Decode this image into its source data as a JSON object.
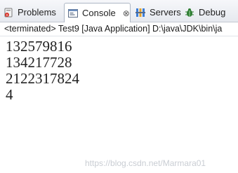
{
  "tabs": [
    {
      "label": "Problems",
      "icon": "problems-icon"
    },
    {
      "label": "Console",
      "icon": "console-icon",
      "close": "⊗"
    },
    {
      "label": "Servers",
      "icon": "servers-icon"
    },
    {
      "label": "Debug",
      "icon": "debug-icon"
    }
  ],
  "console_header": "<terminated> Test9 [Java Application] D:\\java\\JDK\\bin\\ja",
  "output_lines": [
    "132579816",
    "134217728",
    "2122317824",
    "4"
  ],
  "watermark": "https://blog.csdn.net/Marmara01",
  "colors": {
    "tab_background": "#e6e9ef",
    "active_tab": "#ffffff",
    "console_text": "#222222",
    "servers_icon": "#3b7dd8",
    "debug_icon": "#2e7d32"
  }
}
